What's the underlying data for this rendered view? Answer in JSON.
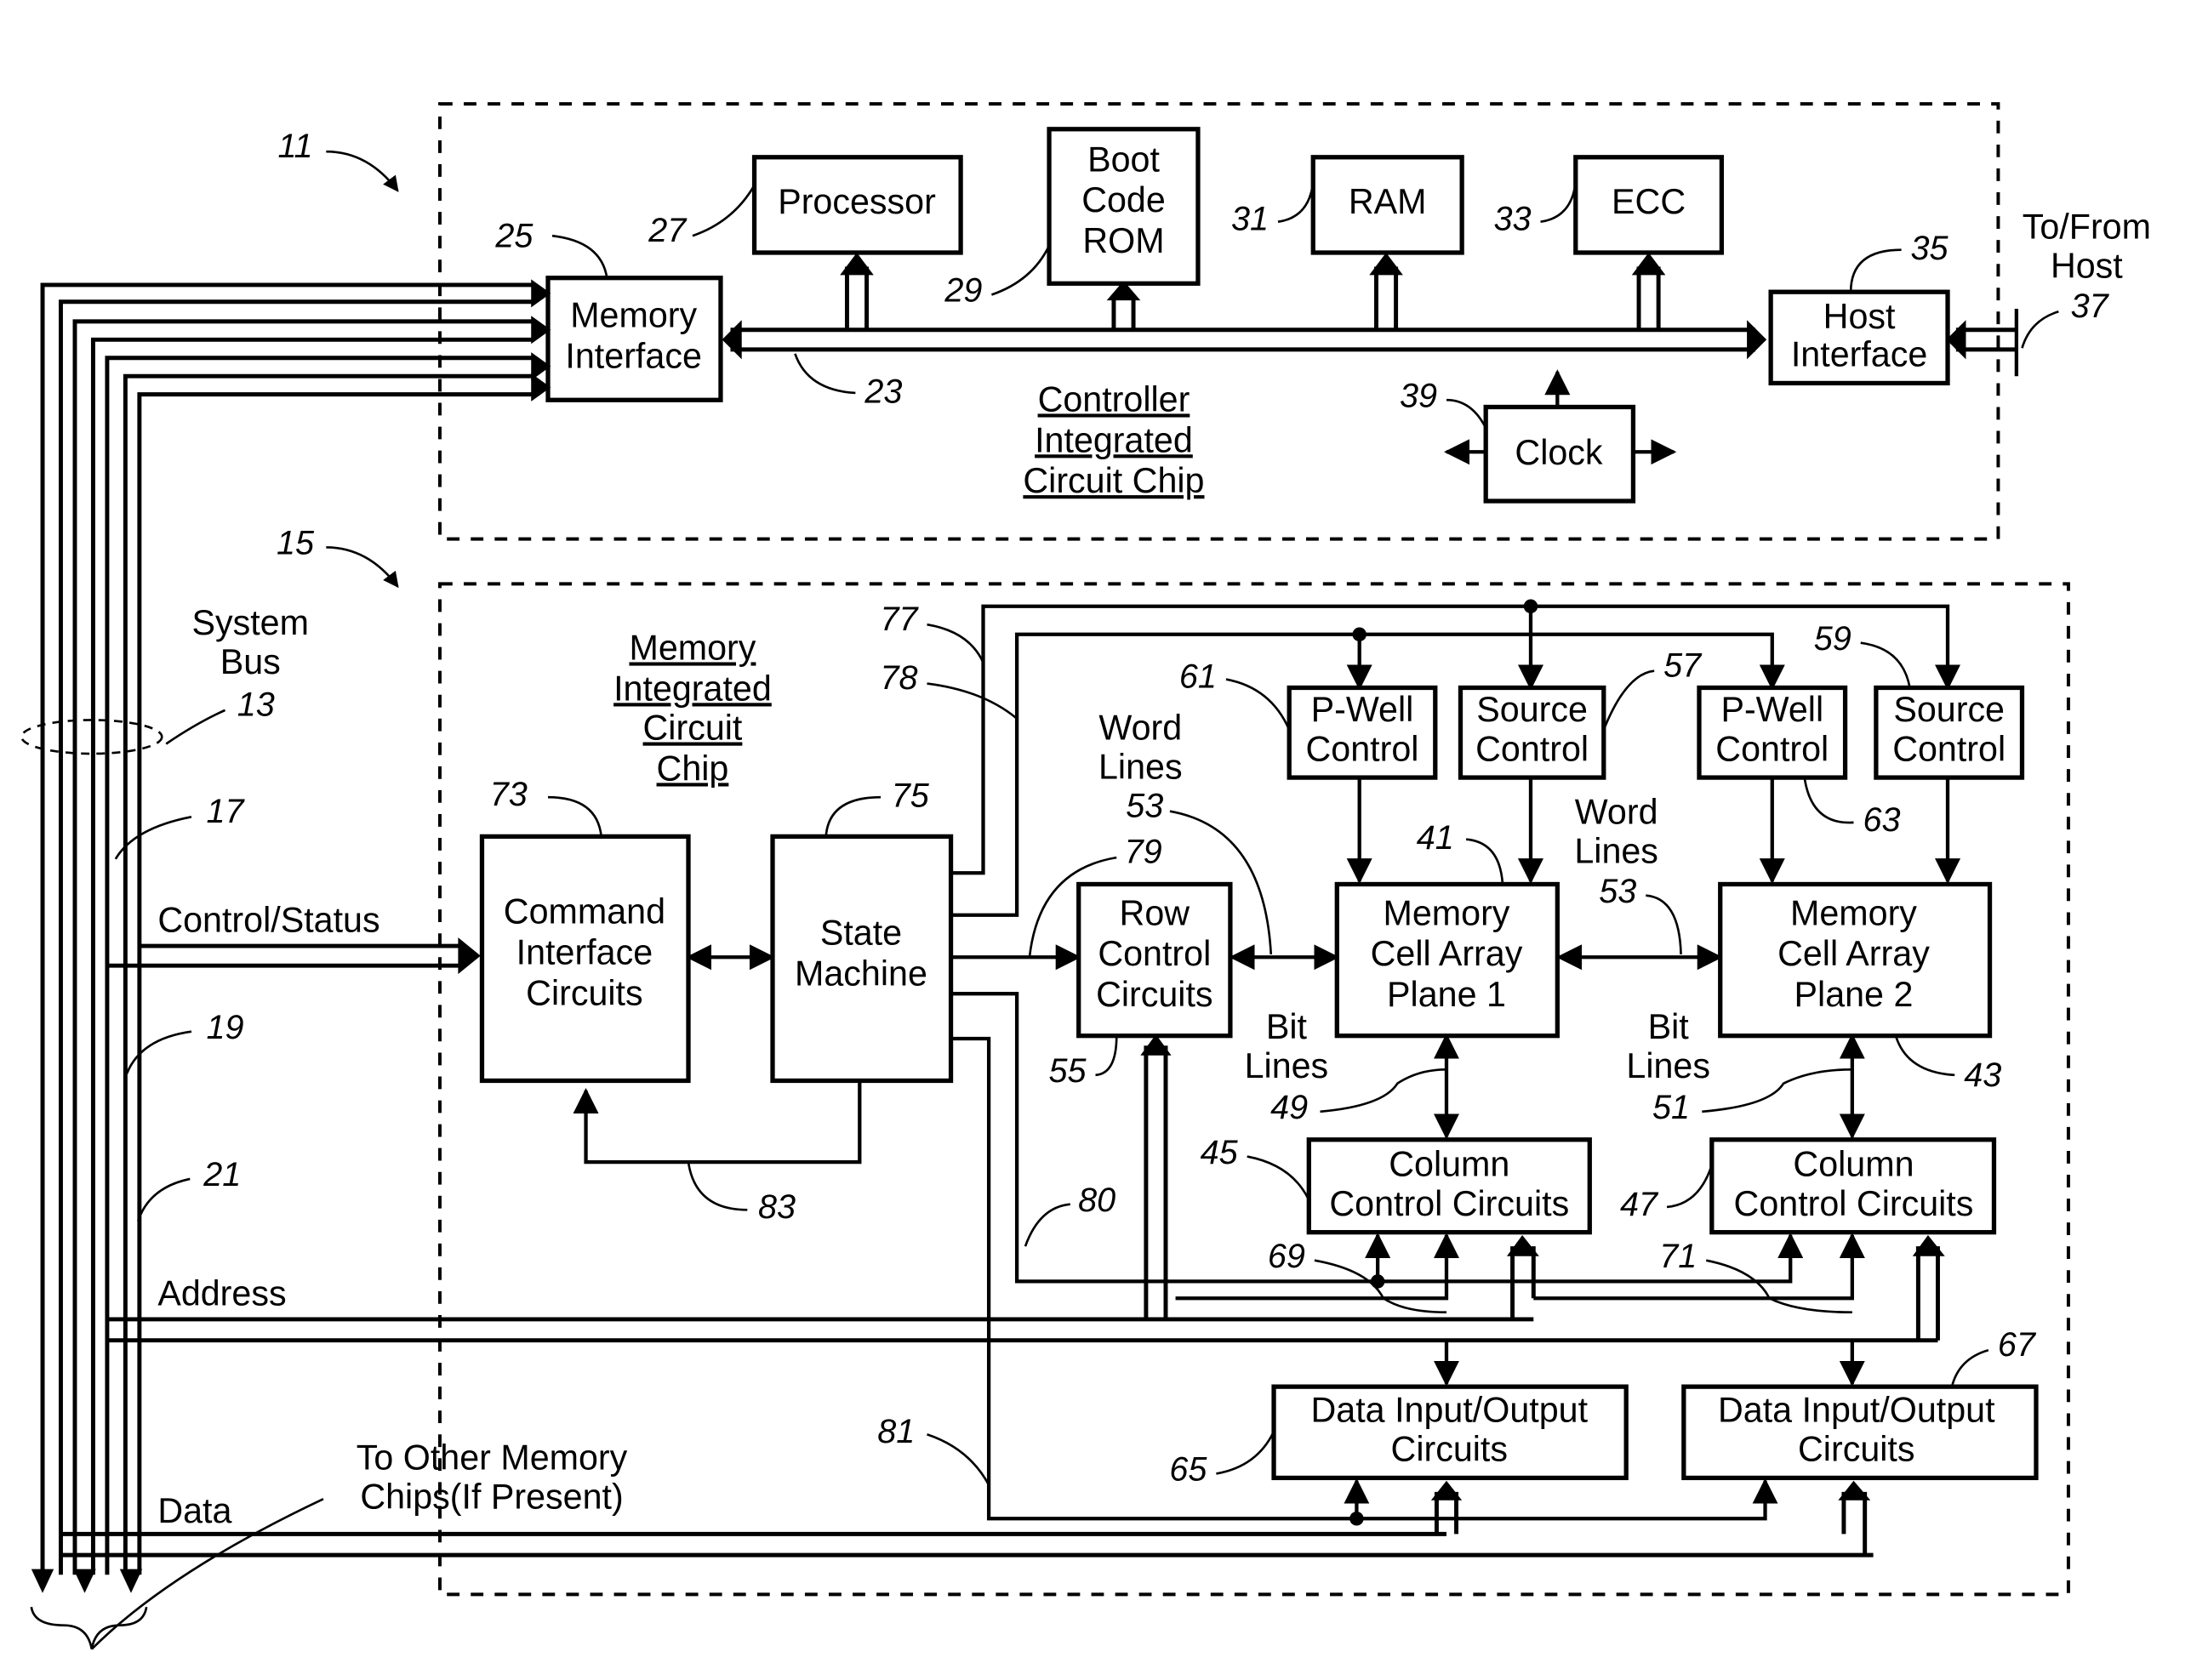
{
  "figure": {
    "controller_chip": {
      "title_lines": [
        "Controller",
        "Integrated",
        "Circuit Chip"
      ],
      "ref": "11",
      "blocks": {
        "memory_interface": {
          "lines": [
            "Memory",
            "Interface"
          ],
          "ref": "25"
        },
        "processor": {
          "lines": [
            "Processor"
          ],
          "ref": "27"
        },
        "boot_rom": {
          "lines": [
            "Boot",
            "Code",
            "ROM"
          ],
          "ref": "29"
        },
        "ram": {
          "lines": [
            "RAM"
          ],
          "ref": "31"
        },
        "ecc": {
          "lines": [
            "ECC"
          ],
          "ref": "33"
        },
        "host_interface": {
          "lines": [
            "Host",
            "Interface"
          ],
          "ref": "35"
        },
        "clock": {
          "lines": [
            "Clock"
          ],
          "ref": "39"
        }
      },
      "internal_bus_ref": "23",
      "host_link": {
        "lines": [
          "To/From",
          "Host"
        ],
        "ref": "37"
      }
    },
    "memory_chip": {
      "title_lines": [
        "Memory",
        "Integrated",
        "Circuit",
        "Chip"
      ],
      "ref": "15",
      "blocks": {
        "command_interface": {
          "lines": [
            "Command",
            "Interface",
            "Circuits"
          ],
          "ref": "73"
        },
        "state_machine": {
          "lines": [
            "State",
            "Machine"
          ],
          "ref": "75"
        },
        "row_control": {
          "lines": [
            "Row",
            "Control",
            "Circuits"
          ],
          "ref": "55"
        },
        "plane1": {
          "lines": [
            "Memory",
            "Cell Array",
            "Plane 1"
          ],
          "ref": "41"
        },
        "plane2": {
          "lines": [
            "Memory",
            "Cell Array",
            "Plane 2"
          ],
          "ref": "43"
        },
        "pwell1": {
          "lines": [
            "P-Well",
            "Control"
          ],
          "ref": "61"
        },
        "source1": {
          "lines": [
            "Source",
            "Control"
          ],
          "ref": "57"
        },
        "pwell2": {
          "lines": [
            "P-Well",
            "Control"
          ],
          "ref": "63"
        },
        "source2": {
          "lines": [
            "Source",
            "Control"
          ],
          "ref": "59"
        },
        "col1": {
          "lines": [
            "Column",
            "Control Circuits"
          ],
          "ref": "45"
        },
        "col2": {
          "lines": [
            "Column",
            "Control Circuits"
          ],
          "ref": "47"
        },
        "dio1": {
          "lines": [
            "Data Input/Output",
            "Circuits"
          ],
          "ref": "65"
        },
        "dio2": {
          "lines": [
            "Data Input/Output",
            "Circuits"
          ],
          "ref": "67"
        }
      },
      "signal_labels": {
        "word_lines_1": {
          "lines": [
            "Word",
            "Lines"
          ],
          "ref": "53"
        },
        "word_lines_2": {
          "lines": [
            "Word",
            "Lines"
          ],
          "ref": "53"
        },
        "bit_lines_1": {
          "lines": [
            "Bit",
            "Lines"
          ],
          "ref": "49"
        },
        "bit_lines_2": {
          "lines": [
            "Bit",
            "Lines"
          ],
          "ref": "51"
        }
      },
      "line_refs": [
        "77",
        "78",
        "79",
        "80",
        "81",
        "83",
        "69",
        "71"
      ]
    },
    "system_bus": {
      "lines": [
        "System",
        "Bus"
      ],
      "ref": "13",
      "ref_17": "17",
      "ref_19": "19",
      "ref_21": "21",
      "control_status": "Control/Status",
      "address": "Address",
      "data": "Data",
      "other_chips": [
        "To Other Memory",
        "Chips(If Present)"
      ]
    }
  }
}
